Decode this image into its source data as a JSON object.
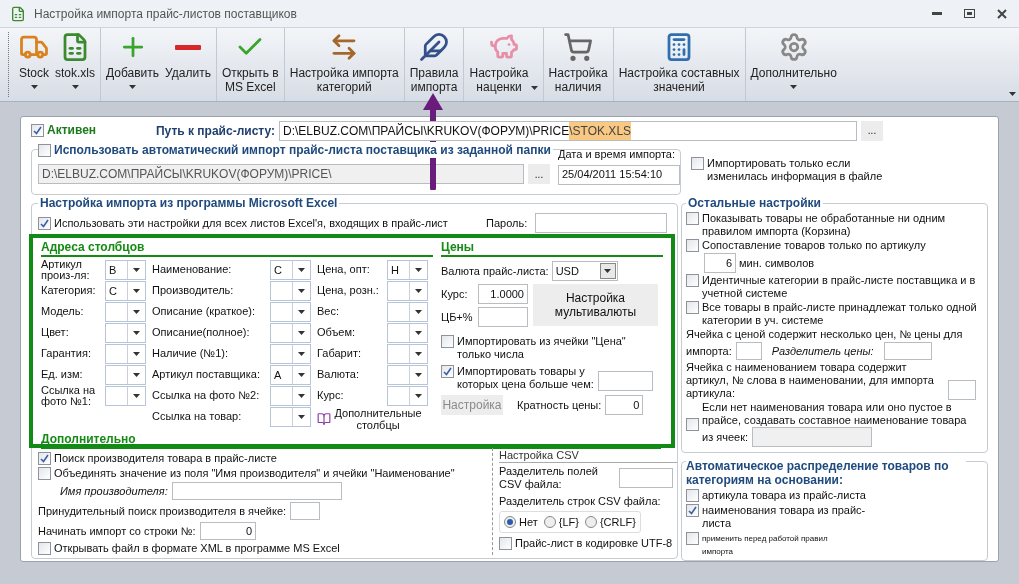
{
  "window": {
    "title": "Настройка импорта прайс-листов поставщиков"
  },
  "toolbar": {
    "groups": [
      [
        {
          "label": "Stock",
          "kind": "menu"
        },
        {
          "label": "stok.xls",
          "kind": "menu"
        }
      ],
      [
        {
          "label": "Добавить",
          "kind": "menu"
        },
        {
          "label": "Удалить",
          "kind": "button"
        }
      ],
      [
        {
          "label": "Открыть в\nMS Excel",
          "kind": "button"
        }
      ],
      [
        {
          "label": "Настройка импорта\nкатегорий",
          "kind": "button"
        }
      ],
      [
        {
          "label": "Правила\nимпорта",
          "kind": "button"
        }
      ],
      [
        {
          "label": "Настройка\nнаценки",
          "kind": "inline-menu"
        }
      ],
      [
        {
          "label": "Настройка\nналичия",
          "kind": "button"
        }
      ],
      [
        {
          "label": "Настройка составных\nзначений",
          "kind": "button"
        }
      ],
      [
        {
          "label": "Дополнительно",
          "kind": "menu"
        }
      ]
    ]
  },
  "active": {
    "label": "Активен",
    "checked": true
  },
  "path": {
    "label": "Путь к прайс-листу:",
    "value": "D:\\ELBUZ.COM\\ПРАЙСЫ\\KRUKOV(ФОРУМ)\\PRICE",
    "selected_text": "\\STOK.XLS",
    "browse": "..."
  },
  "auto_import": {
    "label": "Использовать автоматический импорт прайс-листа поставщика из заданной папки",
    "checked": false,
    "folder": "D:\\ELBUZ.COM\\ПРАЙСЫ\\KRUKOV(ФОРУМ)\\PRICE\\",
    "browse": "...",
    "date_label": "Дата и время импорта:",
    "date": "25/04/2011 15:54:10"
  },
  "only_if_changed": {
    "label": "Импортировать только если изменилась информация в файле",
    "checked": false
  },
  "excel": {
    "title": "Настройка импорта из программы Microsoft Excel",
    "all_sheets": {
      "label": "Использовать эти настройки для всех листов Excel'я, входящих в прайс-лист",
      "checked": true
    },
    "password_label": "Пароль:"
  },
  "columns": {
    "title": "Адреса столбцов",
    "groups": [
      [
        {
          "label": "Артикул произ-ля:",
          "value": "B"
        },
        {
          "label": "Категория:",
          "value": "C"
        },
        {
          "label": "Модель:"
        },
        {
          "label": "Цвет:"
        },
        {
          "label": "Гарантия:"
        },
        {
          "label": "Ед. изм:"
        },
        {
          "label": "Ссылка на фото №1:"
        }
      ],
      [
        {
          "label": "Наименование:",
          "value": "C"
        },
        {
          "label": "Производитель:"
        },
        {
          "label": "Описание (краткое):"
        },
        {
          "label": "Описание(полное):"
        },
        {
          "label": "Наличие (№1):"
        },
        {
          "label": "Артикул поставщика:",
          "value": "A"
        },
        {
          "label": "Ссылка на фото №2:"
        },
        {
          "label": "Ссылка на товар:"
        }
      ],
      [
        {
          "label": "Цена, опт:",
          "value": "H"
        },
        {
          "label": "Цена, розн.:"
        },
        {
          "label": "Вес:"
        },
        {
          "label": "Объем:"
        },
        {
          "label": "Габарит:"
        },
        {
          "label": "Валюта:"
        },
        {
          "label": "Курс:"
        }
      ]
    ],
    "extra_button": "Дополнительные столбцы"
  },
  "prices": {
    "title": "Цены",
    "currency_label": "Валюта прайс-листа:",
    "currency": "USD",
    "rate_label": "Курс:",
    "rate": "1.0000",
    "cb_label": "ЦБ+%",
    "multicurrency_button": "Настройка мультивалюты",
    "numbers_only": {
      "label": "Импортировать из ячейки \"Цена\" только числа",
      "checked": false
    },
    "price_above": {
      "label": "Импортировать товары у которых цена больше чем:",
      "checked": true
    },
    "settings_button": {
      "label": "Настройка",
      "disabled": true
    },
    "multiple_label": "Кратность цены:",
    "multiple": "0"
  },
  "additional": {
    "title": "Дополнительно",
    "search_manufacturer": {
      "label": "Поиск производителя товара в прайс-листе",
      "checked": true
    },
    "merge": {
      "label": "Объединять значение из поля \"Имя производителя\" и ячейки \"Наименование\"",
      "checked": false
    },
    "manufacturer_label": "Имя производителя:",
    "forced_search_label": "Принудительный поиск производителя в ячейке:",
    "start_row_label": "Начинать импорт со строки №:",
    "start_row": "0",
    "open_xml": {
      "label": "Открывать файл в формате XML в программе MS Excel",
      "checked": false
    }
  },
  "csv": {
    "title": "Настройка CSV",
    "field_separator_label": "Разделитель полей CSV файла:",
    "row_separator_label": "Разделитель строк CSV файла:",
    "options": [
      {
        "label": "Нет",
        "selected": true
      },
      {
        "label": "{LF}",
        "selected": false
      },
      {
        "label": "{CRLF}",
        "selected": false
      }
    ],
    "utf8": {
      "label": "Прайс-лист в кодировке UTF-8",
      "checked": false
    }
  },
  "other": {
    "title": "Остальные настройки",
    "show_unprocessed": {
      "label": "Показывать товары не обработанные ни одним правилом импорта (Корзина)",
      "checked": false
    },
    "match_by_article": {
      "label": "Сопоставление товаров только по артикулу",
      "checked": false
    },
    "min_symbols": "6",
    "min_symbols_label": "мин. символов",
    "identical_categories": {
      "label": "Идентичные категории в прайс-листе поставщика и в учетной системе",
      "checked": false
    },
    "one_category": {
      "label": "Все товары в прайс-листе принадлежат только одной категории в уч. системе",
      "checked": false
    },
    "multi_price_label": "Ячейка с ценой содержит несколько цен, № цены для",
    "multi_price_label_end": "импорта:",
    "price_separator_label": "Разделитель цены:",
    "article_in_name_label": "Ячейка с наименованием товара содержит артикул, № слова в наименовании, для импорта артикула:",
    "compose_name": {
      "label": "Если нет наименования товара или оно пустое в прайсе, создавать составное наименование товара",
      "checked": false
    },
    "compose_cells_label": "из ячеек:"
  },
  "distribution": {
    "title": "Автоматическое распределение товаров по категориям на основании:",
    "options": [
      {
        "label": "артикула товара из прайс-листа",
        "checked": false,
        "kind": "normal"
      },
      {
        "label": "наименования товара из прайс-листа",
        "checked": true,
        "kind": "normal"
      },
      {
        "label": "применить перед работой правил импорта",
        "checked": false,
        "kind": "small"
      }
    ]
  }
}
